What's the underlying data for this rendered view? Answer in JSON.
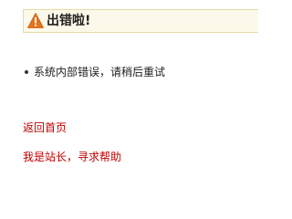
{
  "header": {
    "icon": "warning-icon",
    "icon_color": "#e8731c",
    "title": "出错啦!"
  },
  "messages": [
    {
      "text": "系统内部错误，请稍后重试"
    }
  ],
  "links": {
    "home": "返回首页",
    "help": "我是站长，寻求帮助",
    "color": "#c00000"
  }
}
